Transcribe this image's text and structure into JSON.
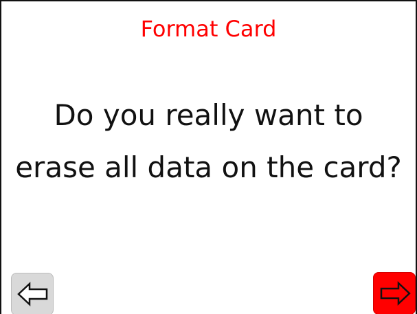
{
  "dialog": {
    "title": "Format Card",
    "message": "Do you really want to erase all data on the card?"
  },
  "controls": {
    "back": {
      "icon": "left-arrow-icon",
      "color": "#d9d9d9"
    },
    "confirm": {
      "icon": "right-arrow-icon",
      "color": "#ff0000"
    }
  },
  "colors": {
    "title": "#ff0000",
    "text": "#111111",
    "background": "#ffffff"
  }
}
